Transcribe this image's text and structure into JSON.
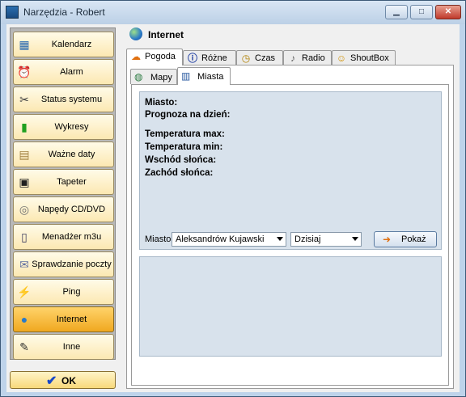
{
  "window": {
    "title": "Narzędzia - Robert"
  },
  "sidebar": {
    "items": [
      {
        "label": "Kalendarz",
        "icon": "calendar-icon",
        "glyph": "▦"
      },
      {
        "label": "Alarm",
        "icon": "alarm-clock-icon",
        "glyph": "⏰"
      },
      {
        "label": "Status systemu",
        "icon": "tools-icon",
        "glyph": "✂"
      },
      {
        "label": "Wykresy",
        "icon": "bar-chart-icon",
        "glyph": "▮"
      },
      {
        "label": "Ważne daty",
        "icon": "notes-icon",
        "glyph": "▤"
      },
      {
        "label": "Tapeter",
        "icon": "monitor-icon",
        "glyph": "▣"
      },
      {
        "label": "Napędy CD/DVD",
        "icon": "cd-icon",
        "glyph": "◎"
      },
      {
        "label": "Menadżer m3u",
        "icon": "playlist-file-icon",
        "glyph": "▯"
      },
      {
        "label": "Sprawdzanie poczty",
        "icon": "mail-icon",
        "glyph": "✉"
      },
      {
        "label": "Ping",
        "icon": "network-cable-icon",
        "glyph": "⚡"
      },
      {
        "label": "Internet",
        "icon": "globe-icon",
        "glyph": "●"
      },
      {
        "label": "Inne",
        "icon": "misc-tools-icon",
        "glyph": "✎"
      }
    ],
    "active_index": 10
  },
  "ok_button": {
    "label": "OK"
  },
  "main": {
    "title": "Internet",
    "tabs": [
      {
        "label": "Pogoda",
        "icon": "weather-icon",
        "glyph": "☁"
      },
      {
        "label": "Różne",
        "icon": "info-icon",
        "glyph": "ⓘ"
      },
      {
        "label": "Czas",
        "icon": "clock-icon",
        "glyph": "◷"
      },
      {
        "label": "Radio",
        "icon": "speaker-icon",
        "glyph": "♪"
      },
      {
        "label": "ShoutBox",
        "icon": "smiley-icon",
        "glyph": "☺"
      }
    ],
    "selected_tab": "Pogoda",
    "subtabs": [
      {
        "label": "Mapy",
        "icon": "globe-icon",
        "glyph": "◍"
      },
      {
        "label": "Miasta",
        "icon": "city-chart-icon",
        "glyph": "▥"
      }
    ],
    "selected_subtab": "Miasta"
  },
  "weather": {
    "city_label": "Miasto:",
    "forecast_label": "Prognoza na dzień:",
    "temp_max_label": "Temperatura max:",
    "temp_min_label": "Temperatura min:",
    "sunrise_label": "Wschód słońca:",
    "sunset_label": "Zachód słońca:",
    "city_select_label": "Miasto:",
    "city_value": "Aleksandrów Kujawski",
    "day_value": "Dzisiaj",
    "show_button": "Pokaż"
  },
  "colors": {
    "accent": "#f0a820",
    "panel": "#d8e2ec",
    "window_frame": "#bed3ea"
  }
}
